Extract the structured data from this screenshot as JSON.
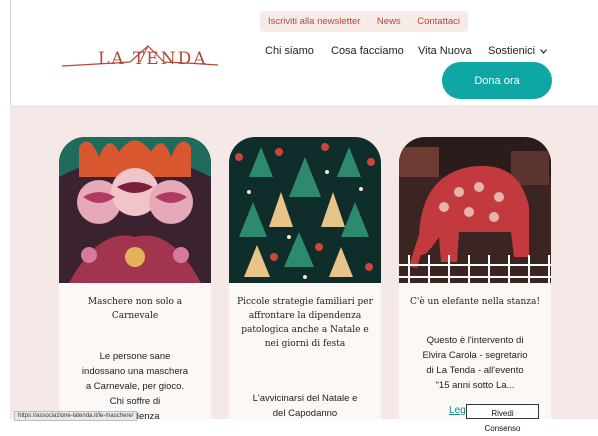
{
  "topbar": {
    "newsletter": "Iscriviti alla newsletter",
    "news": "News",
    "contact": "Contattaci"
  },
  "logo": {
    "text": "LA TENDA"
  },
  "mainnav": {
    "items": [
      "Chi siamo",
      "Cosa facciamo",
      "Vita Nuova",
      "Sostienici"
    ],
    "dropdown_icon": "chevron-down-icon"
  },
  "donate": {
    "label": "Dona ora"
  },
  "colors": {
    "accent": "#0fa7a3",
    "brand": "#b24a39",
    "band": "#f4e9e6"
  },
  "cards": [
    {
      "title": "Maschere non solo a Carnevale",
      "body": [
        "Le persone sane",
        "indossano una maschera",
        "a Carnevale, per gioco.",
        "Chi soffre di",
        "dipendenza"
      ]
    },
    {
      "title": "Piccole strategie familiari per affrontare la dipendenza patologica anche a Natale e nei giorni di festa",
      "body": [
        "L'avvicinarsi del Natale e",
        "del Capodanno"
      ]
    },
    {
      "title": "C'è un elefante nella stanza!",
      "body": [
        "Questo è l'intervento di",
        "Elvira Carola - segretario",
        "di La Tenda - all'evento",
        "\"15 anni sotto La..."
      ],
      "readmore": "Leggi"
    }
  ],
  "statusbar": {
    "url": "https://associazione-latenda.it/le-maschere/"
  },
  "consent": {
    "label": "Rivedi Consenso"
  }
}
